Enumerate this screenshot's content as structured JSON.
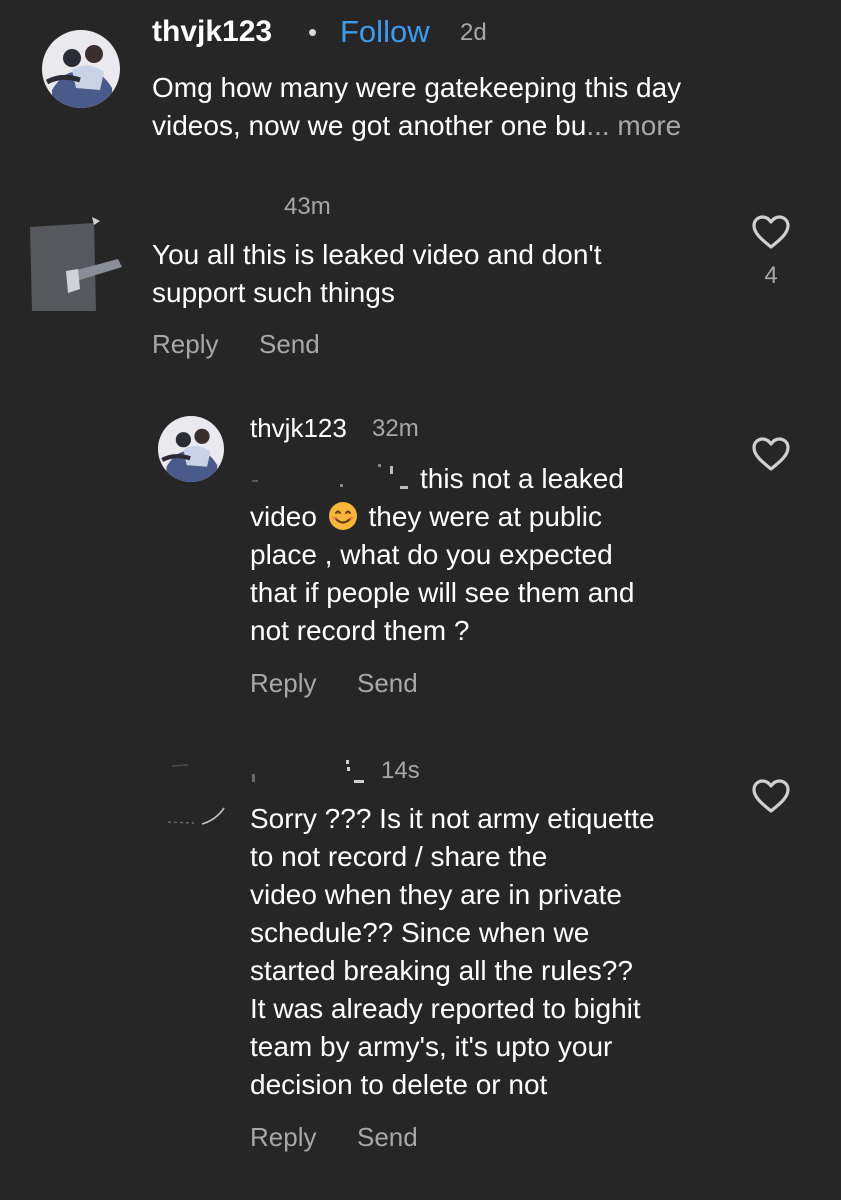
{
  "comments": [
    {
      "username": "thvjk123",
      "separator": "•",
      "follow_label": "Follow",
      "time": "2d",
      "text": "Omg how many were gatekeeping this day\nvideos, now we got another one bu",
      "ellipsis": "...",
      "more_label": " more"
    },
    {
      "username": "",
      "time": "43m",
      "text": "You all this is leaked video and don't\nsupport such things",
      "reply_label": "Reply",
      "send_label": "Send",
      "like_count": "4"
    },
    {
      "username": "thvjk123",
      "time": "32m",
      "text_line1": "this not a leaked",
      "text_pre_emoji": "video",
      "emoji_name": "smiling-face-icon",
      "text_post_emoji": "they were at public",
      "text_rest": "place , what do you expected\nthat if people will see them and\nnot record them ?",
      "reply_label": "Reply",
      "send_label": "Send"
    },
    {
      "username": "",
      "time": "14s",
      "text": "Sorry ??? Is it not army etiquette\nto not record / share the\nvideo when they are in private\nschedule?? Since when we\nstarted breaking all the rules??\nIt was already reported to bighit\nteam by army's,  it's upto your\ndecision  to delete or not",
      "reply_label": "Reply",
      "send_label": "Send"
    }
  ],
  "colors": {
    "background": "#262626",
    "text": "#ffffff",
    "secondary": "#a8a8a8",
    "follow": "#3d9bf0"
  }
}
